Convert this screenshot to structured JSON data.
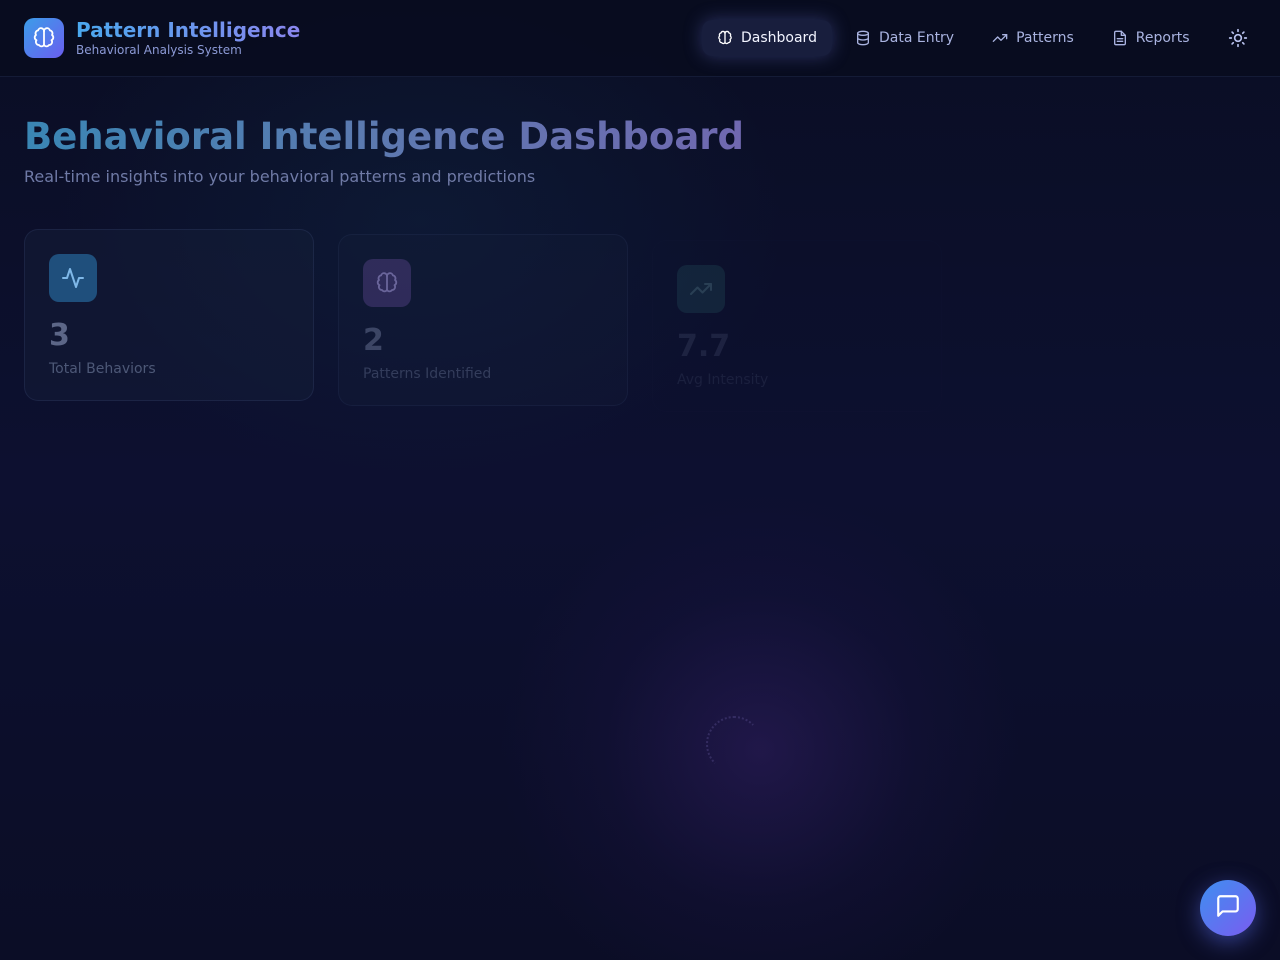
{
  "brand": {
    "title": "Pattern Intelligence",
    "subtitle": "Behavioral Analysis System",
    "icon": "brain-icon"
  },
  "nav": {
    "items": [
      {
        "label": "Dashboard",
        "icon": "brain-icon",
        "active": true
      },
      {
        "label": "Data Entry",
        "icon": "database-icon",
        "active": false
      },
      {
        "label": "Patterns",
        "icon": "trending-up-icon",
        "active": false
      },
      {
        "label": "Reports",
        "icon": "file-text-icon",
        "active": false
      }
    ],
    "theme_toggle_icon": "sun-icon"
  },
  "page": {
    "title": "Behavioral Intelligence Dashboard",
    "subtitle": "Real-time insights into your behavioral patterns and predictions"
  },
  "stats": [
    {
      "value": "3",
      "label": "Total Behaviors",
      "icon": "activity-icon"
    },
    {
      "value": "2",
      "label": "Patterns Identified",
      "icon": "brain-icon"
    },
    {
      "value": "7.7",
      "label": "Avg Intensity",
      "icon": "trending-up-icon"
    }
  ],
  "chat": {
    "icon": "message-square-icon"
  },
  "colors": {
    "accent_blue": "#3b9de8",
    "accent_purple": "#6a5ef0",
    "background": "#0b0e22"
  }
}
